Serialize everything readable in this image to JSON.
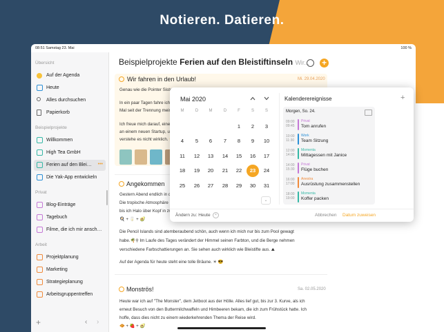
{
  "headline": "Notieren. Datieren.",
  "status_bar": {
    "time_date": "08:51  Samstag 23. Mai",
    "battery": "100 %"
  },
  "sidebar": {
    "overview_label": "Übersicht",
    "overview": [
      {
        "label": "Auf der Agenda",
        "icon": "sun-icon"
      },
      {
        "label": "Heute",
        "icon": "calendar-icon"
      },
      {
        "label": "Alles durchsuchen",
        "icon": "search-icon"
      },
      {
        "label": "Papierkorb",
        "icon": "trash-icon"
      }
    ],
    "examples_label": "Beispielprojekte",
    "examples": [
      {
        "label": "Willkommen"
      },
      {
        "label": "High Tea GmbH"
      },
      {
        "label": "Ferien auf den Blei…",
        "more": "•••"
      },
      {
        "label": "Die Yak-App entwickeln"
      }
    ],
    "private_label": "Privat",
    "private": [
      {
        "label": "Blog-Einträge"
      },
      {
        "label": "Tagebuch"
      },
      {
        "label": "Filme, die ich mir ansch…"
      }
    ],
    "work_label": "Arbeit",
    "work": [
      {
        "label": "Projektplanung"
      },
      {
        "label": "Marketing"
      },
      {
        "label": "Strategieplanung"
      },
      {
        "label": "Arbeitsgruppentreffen"
      }
    ],
    "bottom": {
      "add": "+",
      "back": "‹",
      "forward": "›"
    }
  },
  "main": {
    "title_prefix": "Beispielprojekte",
    "title_bold": "Ferien auf den Bleistiftinseln",
    "title_suffix": "Wir...",
    "add": "+",
    "entry1": {
      "title": "Wir fahren in den Urlaub!",
      "date": "Mi. 29.04.2020",
      "lines": [
        "Genau wie die Pointer Sisters - ich bin heiß",
        "In ein paar Tagen fahre ich endlich mit H",
        "Mal seit der Trennung meiner Eltern vor",
        "Ich freue mich darauf, eine Weile mit ihr",
        "an einem neuen Startup, um Burger auf",
        "verstehe es nicht wirklich. 🤷"
      ]
    },
    "entry2": {
      "title": "Angekommen",
      "lines": [
        "Gestern Abend endlich in den Pencils a",
        "Die tropische Atmosphäre hier sorgt für",
        "bis ich Halo über Kopf in zwei Eiern stee",
        "🍳 + 🥛 + 🥑",
        "Die Pencil Islands sind atemberaubend schön, auch wenn ich mich nur bis zum Pool gewagt",
        "habe.🌴⚲ Im Laufe des Tages verändert der Himmel seinen Farbton, und die Berge nehmen",
        "verschiedene Farbschattierungen an. Sie sehen auch wirklich wie Bleistifte aus. ⛰",
        "Auf der Agenda für heute steht eine tolle Bräune. ☀ 😎"
      ]
    },
    "entry3": {
      "title": "Monströs!",
      "date": "Sa. 02.05.2020",
      "lines": [
        "Heute war ich auf \"The Monster\", dem Jetboot aus der Hölle. Alles lief gut, bis zur 3. Kurve, als ich",
        "erneut Besuch von den Buttermilchwaffeln und Himbeeren bekam, die ich zum Frühstück hatte. Ich",
        "hoffe, dass dies nicht zu einem wiederkehrenden Thema der Reise wird.",
        "🧇 + 🍓 + 🥑"
      ]
    }
  },
  "calendar": {
    "month": "Mai 2020",
    "nav_prev": "^",
    "nav_next": "v",
    "weekdays": [
      "M",
      "D",
      "M",
      "D",
      "F",
      "S",
      "S"
    ],
    "days": [
      [
        "",
        "",
        "",
        "",
        "1",
        "2",
        "3"
      ],
      [
        "4",
        "5",
        "6",
        "7",
        "8",
        "9",
        "10"
      ],
      [
        "11",
        "12",
        "13",
        "14",
        "15",
        "16",
        "17"
      ],
      [
        "18",
        "19",
        "20",
        "21",
        "22",
        "23",
        "24"
      ],
      [
        "25",
        "26",
        "27",
        "28",
        "29",
        "30",
        "31"
      ]
    ],
    "selected_day": "23",
    "expand": "⌄",
    "change_to": "Ändern zu: Heute",
    "cancel": "Abbrechen",
    "assign": "Datum zuweisen",
    "events_title": "Kalenderereignisse",
    "events_add": "+",
    "events_header": "Morgen, So. 24.",
    "events": [
      {
        "time": "09:00\n09:45",
        "calendar": "Privat",
        "name": "Tom anrufen",
        "color": "#c478d6"
      },
      {
        "time": "10:00\n11:30",
        "calendar": "Work",
        "name": "Team Sitzung",
        "color": "#2a8fd6"
      },
      {
        "time": "12:00\n14:00",
        "calendar": "Momenta",
        "name": "Mittagessen mit Janice",
        "color": "#34b7a5"
      },
      {
        "time": "14:00\n15:30",
        "calendar": "Privat",
        "name": "Flüge buchen",
        "color": "#c478d6"
      },
      {
        "time": "16:00\n17:00",
        "calendar": "Anestra",
        "name": "Ausrüstung zusammenstellen",
        "color": "#f08a3a"
      },
      {
        "time": "18:00\n19:00",
        "calendar": "Momenta",
        "name": "Koffer packen",
        "color": "#34b7a5"
      }
    ]
  },
  "colors": {
    "accent": "#f5a623",
    "navy": "#2e4a66"
  }
}
